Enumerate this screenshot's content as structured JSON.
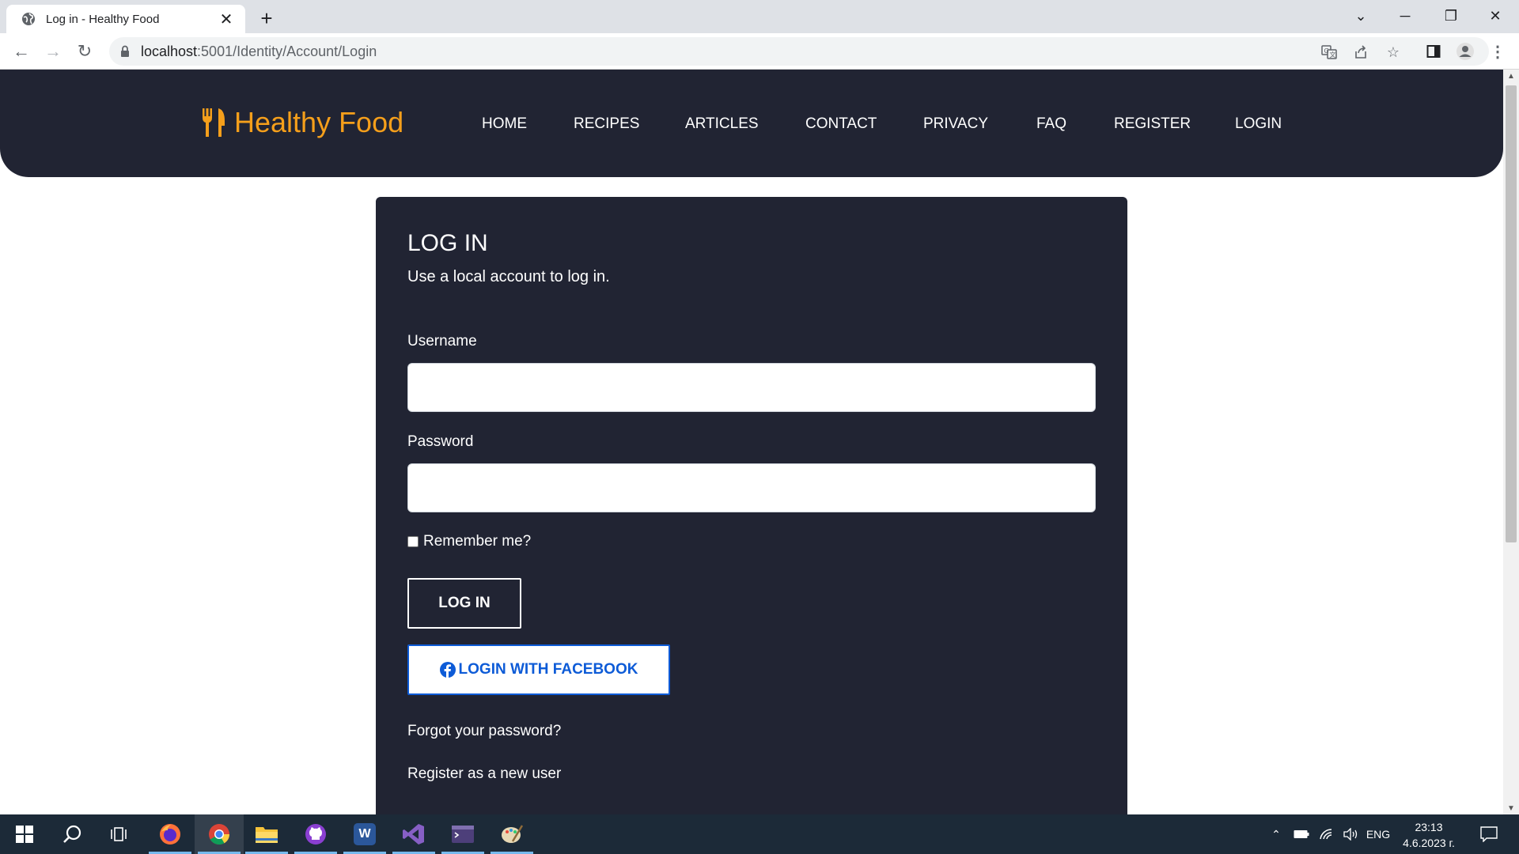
{
  "browser": {
    "tab_title": "Log in - Healthy Food",
    "url_host": "localhost",
    "url_rest": ":5001/Identity/Account/Login"
  },
  "site": {
    "brand": "Healthy Food",
    "brand_color": "#f59f1b",
    "nav": [
      "HOME",
      "RECIPES",
      "ARTICLES",
      "CONTACT",
      "PRIVACY",
      "FAQ",
      "REGISTER",
      "LOGIN"
    ]
  },
  "login": {
    "title": "LOG IN",
    "subtitle": "Use a local account to log in.",
    "username_label": "Username",
    "username_value": "",
    "password_label": "Password",
    "password_value": "",
    "remember_label": "Remember me?",
    "remember_checked": false,
    "login_button": "LOG IN",
    "facebook_button": "LOGIN WITH FACEBOOK",
    "forgot_link": "Forgot your password?",
    "register_link": "Register as a new user"
  },
  "taskbar": {
    "language": "ENG",
    "time": "23:13",
    "date": "4.6.2023 г."
  }
}
